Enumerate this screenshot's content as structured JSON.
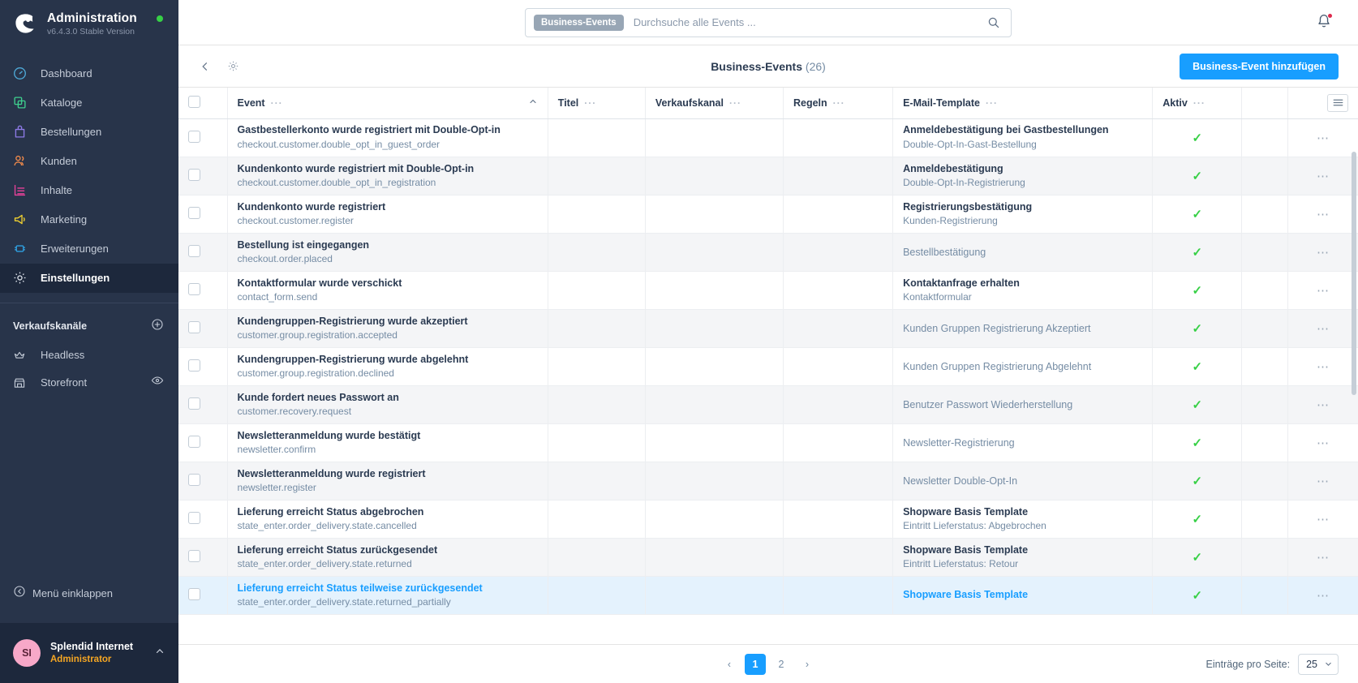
{
  "sidebar": {
    "brand": {
      "title": "Administration",
      "version": "v6.4.3.0 Stable Version"
    },
    "nav": [
      {
        "label": "Dashboard",
        "icon": "dashboard-icon",
        "color": "#4ea8d6",
        "active": false
      },
      {
        "label": "Kataloge",
        "icon": "catalog-icon",
        "color": "#3ecf8e",
        "active": false
      },
      {
        "label": "Bestellungen",
        "icon": "orders-icon",
        "color": "#8d7ae6",
        "active": false
      },
      {
        "label": "Kunden",
        "icon": "customers-icon",
        "color": "#f08a4b",
        "active": false
      },
      {
        "label": "Inhalte",
        "icon": "content-icon",
        "color": "#e8419a",
        "active": false
      },
      {
        "label": "Marketing",
        "icon": "marketing-icon",
        "color": "#f2d230",
        "active": false
      },
      {
        "label": "Erweiterungen",
        "icon": "extensions-icon",
        "color": "#2f9fe0",
        "active": false
      },
      {
        "label": "Einstellungen",
        "icon": "gear-icon",
        "color": "#c5ccd8",
        "active": true
      }
    ],
    "channels_title": "Verkaufskanäle",
    "channels": [
      {
        "label": "Headless",
        "icon": "headless-icon",
        "has_eye": false
      },
      {
        "label": "Storefront",
        "icon": "storefront-icon",
        "has_eye": true
      }
    ],
    "collapse_label": "Menü einklappen",
    "user": {
      "initials": "SI",
      "name": "Splendid Internet",
      "role": "Administrator"
    }
  },
  "topbar": {
    "search_tag": "Business-Events",
    "search_value": "",
    "search_placeholder": "Durchsuche alle Events ..."
  },
  "smartbar": {
    "title": "Business-Events",
    "count": "(26)",
    "add_button": "Business-Event hinzufügen"
  },
  "table": {
    "columns": [
      {
        "label": "Event",
        "sorted": true
      },
      {
        "label": "Titel",
        "sorted": false
      },
      {
        "label": "Verkaufskanal",
        "sorted": false
      },
      {
        "label": "Regeln",
        "sorted": false
      },
      {
        "label": "E-Mail-Template",
        "sorted": false
      },
      {
        "label": "Aktiv",
        "sorted": false
      }
    ],
    "rows": [
      {
        "event_title": "Gastbestellerkonto wurde registriert mit Double-Opt-in",
        "event_key": "checkout.customer.double_opt_in_guest_order",
        "titel": "",
        "verkaufskanal": "",
        "regeln": "",
        "template_title": "Anmeldebestätigung bei Gastbestellungen",
        "template_sub": "Double-Opt-In-Gast-Bestellung",
        "template_plain": "",
        "aktiv": "✓"
      },
      {
        "event_title": "Kundenkonto wurde registriert mit Double-Opt-in",
        "event_key": "checkout.customer.double_opt_in_registration",
        "titel": "",
        "verkaufskanal": "",
        "regeln": "",
        "template_title": "Anmeldebestätigung",
        "template_sub": "Double-Opt-In-Registrierung",
        "template_plain": "",
        "aktiv": "✓"
      },
      {
        "event_title": "Kundenkonto wurde registriert",
        "event_key": "checkout.customer.register",
        "titel": "",
        "verkaufskanal": "",
        "regeln": "",
        "template_title": "Registrierungsbestätigung",
        "template_sub": "Kunden-Registrierung",
        "template_plain": "",
        "aktiv": "✓"
      },
      {
        "event_title": "Bestellung ist eingegangen",
        "event_key": "checkout.order.placed",
        "titel": "",
        "verkaufskanal": "",
        "regeln": "",
        "template_title": "",
        "template_sub": "",
        "template_plain": "Bestellbestätigung",
        "aktiv": "✓"
      },
      {
        "event_title": "Kontaktformular wurde verschickt",
        "event_key": "contact_form.send",
        "titel": "",
        "verkaufskanal": "",
        "regeln": "",
        "template_title": "Kontaktanfrage erhalten",
        "template_sub": "Kontaktformular",
        "template_plain": "",
        "aktiv": "✓"
      },
      {
        "event_title": "Kundengruppen-Registrierung wurde akzeptiert",
        "event_key": "customer.group.registration.accepted",
        "titel": "",
        "verkaufskanal": "",
        "regeln": "",
        "template_title": "",
        "template_sub": "",
        "template_plain": "Kunden Gruppen Registrierung Akzeptiert",
        "aktiv": "✓"
      },
      {
        "event_title": "Kundengruppen-Registrierung wurde abgelehnt",
        "event_key": "customer.group.registration.declined",
        "titel": "",
        "verkaufskanal": "",
        "regeln": "",
        "template_title": "",
        "template_sub": "",
        "template_plain": "Kunden Gruppen Registrierung Abgelehnt",
        "aktiv": "✓"
      },
      {
        "event_title": "Kunde fordert neues Passwort an",
        "event_key": "customer.recovery.request",
        "titel": "",
        "verkaufskanal": "",
        "regeln": "",
        "template_title": "",
        "template_sub": "",
        "template_plain": "Benutzer Passwort Wiederherstellung",
        "aktiv": "✓"
      },
      {
        "event_title": "Newsletteranmeldung wurde bestätigt",
        "event_key": "newsletter.confirm",
        "titel": "",
        "verkaufskanal": "",
        "regeln": "",
        "template_title": "",
        "template_sub": "",
        "template_plain": "Newsletter-Registrierung",
        "aktiv": "✓"
      },
      {
        "event_title": "Newsletteranmeldung wurde registriert",
        "event_key": "newsletter.register",
        "titel": "",
        "verkaufskanal": "",
        "regeln": "",
        "template_title": "",
        "template_sub": "",
        "template_plain": "Newsletter Double-Opt-In",
        "aktiv": "✓"
      },
      {
        "event_title": "Lieferung erreicht Status abgebrochen",
        "event_key": "state_enter.order_delivery.state.cancelled",
        "titel": "",
        "verkaufskanal": "",
        "regeln": "",
        "template_title": "Shopware Basis Template",
        "template_sub": "Eintritt Lieferstatus: Abgebrochen",
        "template_plain": "",
        "aktiv": "✓"
      },
      {
        "event_title": "Lieferung erreicht Status zurückgesendet",
        "event_key": "state_enter.order_delivery.state.returned",
        "titel": "",
        "verkaufskanal": "",
        "regeln": "",
        "template_title": "Shopware Basis Template",
        "template_sub": "Eintritt Lieferstatus: Retour",
        "template_plain": "",
        "aktiv": "✓"
      },
      {
        "event_title": "Lieferung erreicht Status teilweise zurückgesendet",
        "event_key": "state_enter.order_delivery.state.returned_partially",
        "titel": "",
        "verkaufskanal": "",
        "regeln": "",
        "template_title": "Shopware Basis Template",
        "template_sub": "",
        "template_plain": "",
        "aktiv": "✓"
      }
    ],
    "row_action_dots": "⋯"
  },
  "pagination": {
    "prev": "‹",
    "next": "›",
    "pages": [
      "1",
      "2"
    ],
    "current": "1",
    "per_page_label": "Einträge pro Seite:",
    "per_page_value": "25"
  },
  "colors": {
    "accent": "#189eff",
    "sidebar_bg": "#28344a",
    "success": "#37d046",
    "alert": "#de294c"
  }
}
